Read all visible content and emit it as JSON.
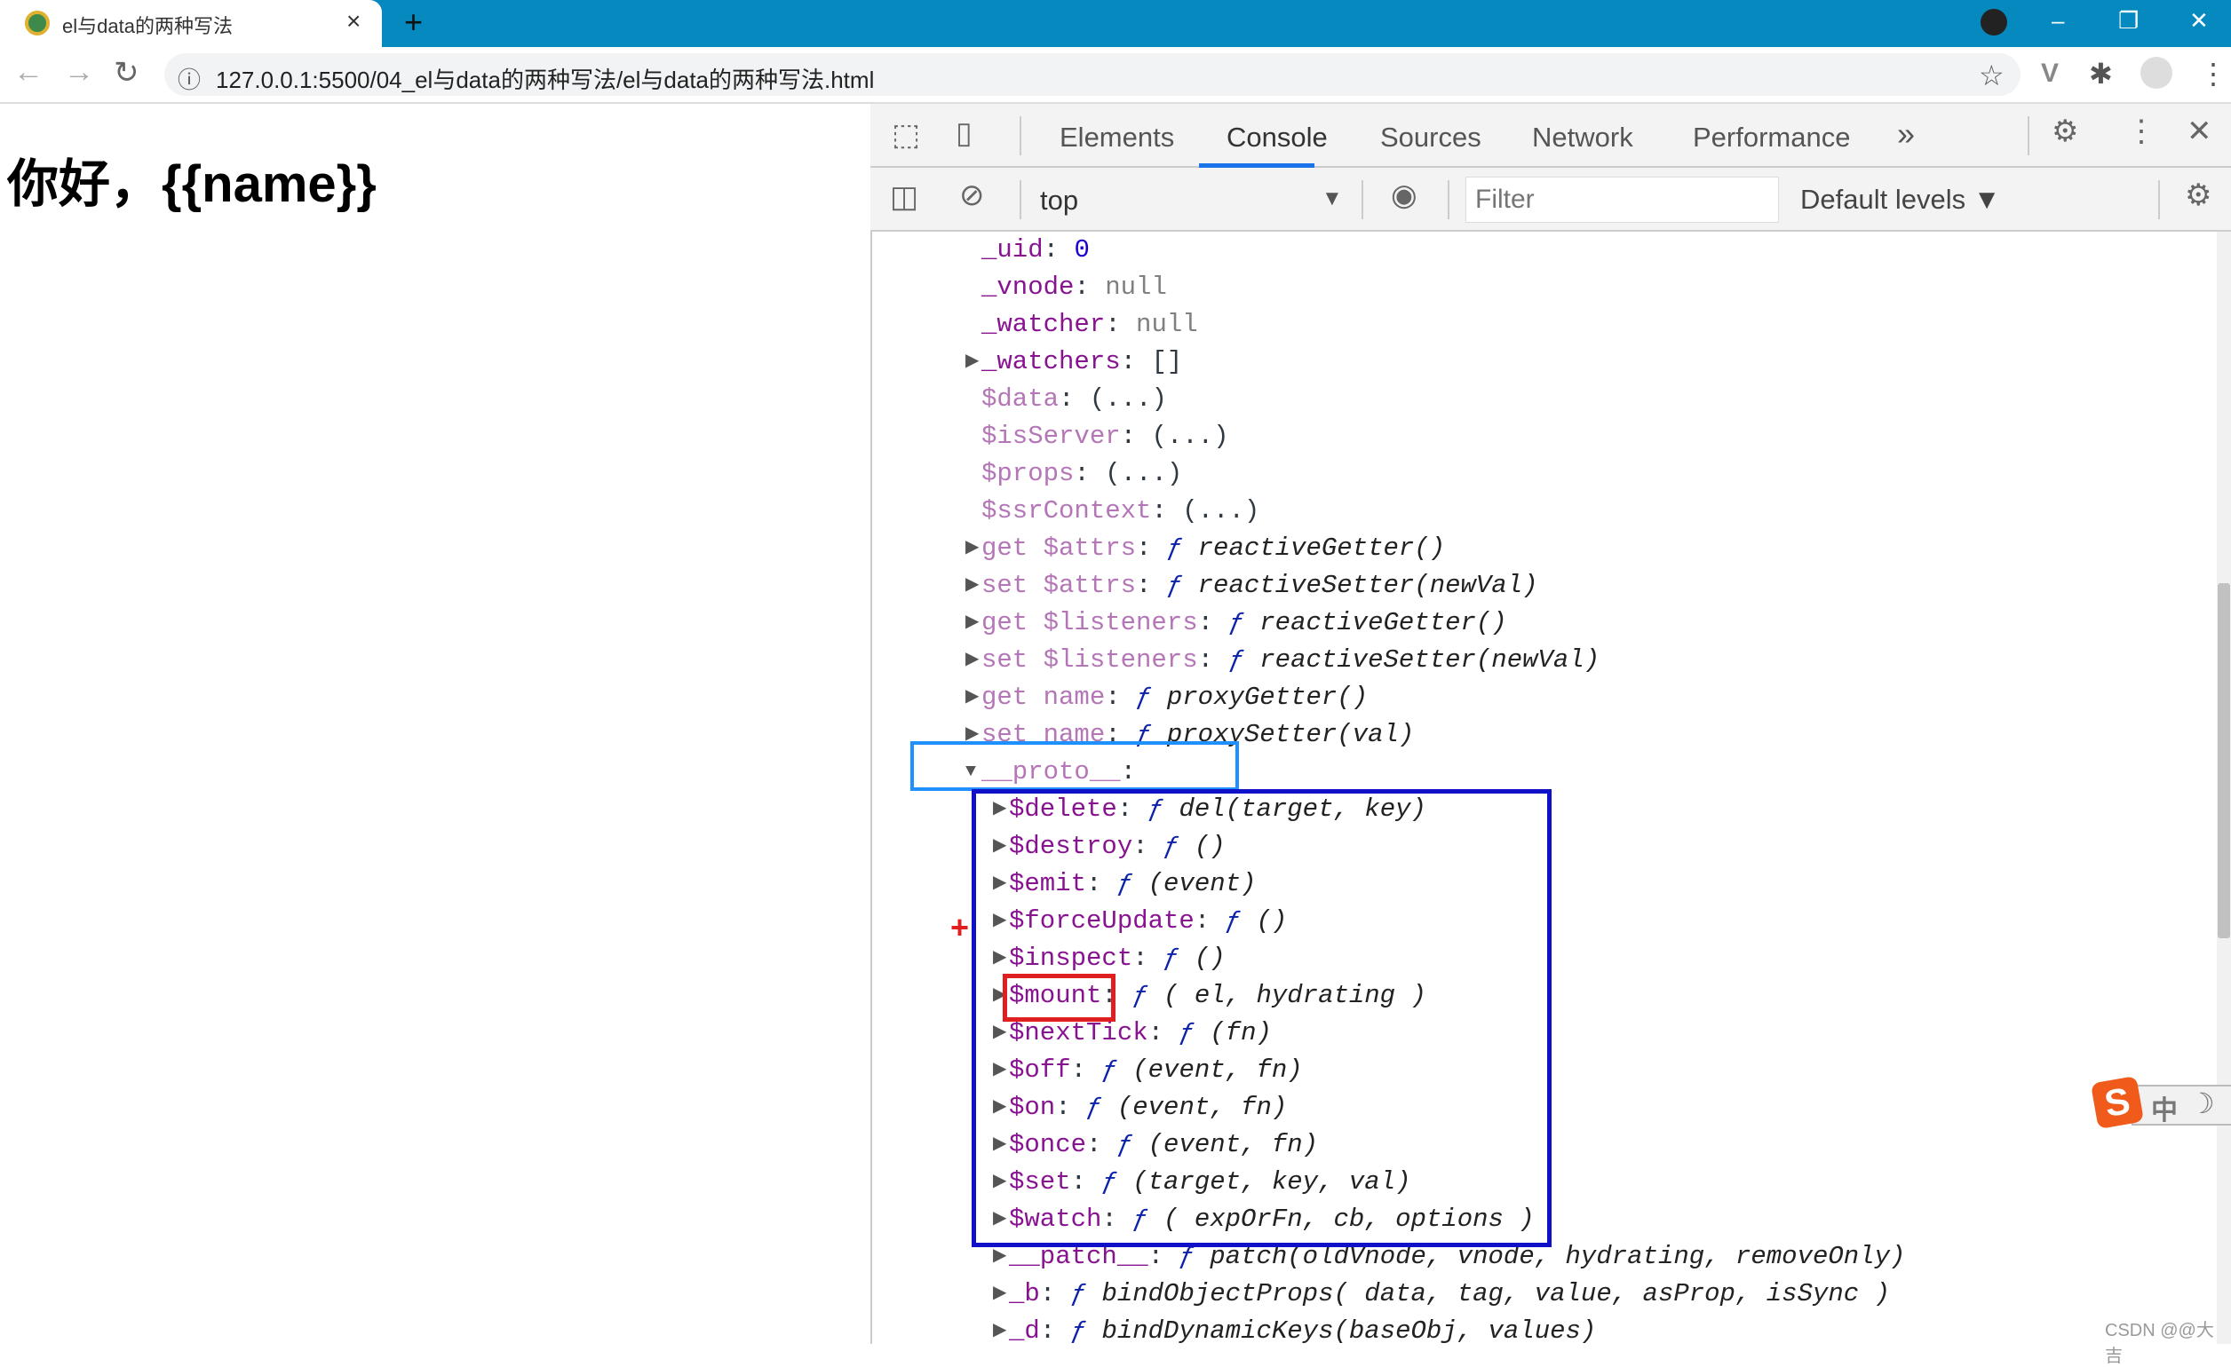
{
  "browser": {
    "tab_title": "el与data的两种写法",
    "tab_close": "×",
    "new_tab": "+",
    "url": "127.0.0.1:5500/04_el与data的两种写法/el与data的两种写法.html",
    "window_controls": {
      "minimize": "–",
      "restore": "❐",
      "close": "✕"
    }
  },
  "page": {
    "heading": "你好，{{name}}"
  },
  "devtools": {
    "tabs": [
      "Elements",
      "Console",
      "Sources",
      "Network",
      "Performance"
    ],
    "active_tab": "Console",
    "more_tabs": "»",
    "context": "top",
    "filter_placeholder": "Filter",
    "levels": "Default levels ▼",
    "console_lines": [
      {
        "indent": 0,
        "arrow": "",
        "key": "_uid",
        "dim": false,
        "val": "0",
        "vt": "num"
      },
      {
        "indent": 0,
        "arrow": "",
        "key": "_vnode",
        "dim": false,
        "val": "null",
        "vt": "nul"
      },
      {
        "indent": 0,
        "arrow": "",
        "key": "_watcher",
        "dim": false,
        "val": "null",
        "vt": "nul"
      },
      {
        "indent": 0,
        "arrow": "▶",
        "key": "_watchers",
        "dim": false,
        "val": "[]",
        "vt": "p"
      },
      {
        "indent": 0,
        "arrow": "",
        "key": "$data",
        "dim": true,
        "val": "(...)",
        "vt": "p"
      },
      {
        "indent": 0,
        "arrow": "",
        "key": "$isServer",
        "dim": true,
        "val": "(...)",
        "vt": "p"
      },
      {
        "indent": 0,
        "arrow": "",
        "key": "$props",
        "dim": true,
        "val": "(...)",
        "vt": "p"
      },
      {
        "indent": 0,
        "arrow": "",
        "key": "$ssrContext",
        "dim": true,
        "val": "(...)",
        "vt": "p"
      },
      {
        "indent": 0,
        "arrow": "▶",
        "key": "get $attrs",
        "dim": true,
        "val": "reactiveGetter()",
        "vt": "fn"
      },
      {
        "indent": 0,
        "arrow": "▶",
        "key": "set $attrs",
        "dim": true,
        "val": "reactiveSetter(newVal)",
        "vt": "fn"
      },
      {
        "indent": 0,
        "arrow": "▶",
        "key": "get $listeners",
        "dim": true,
        "val": "reactiveGetter()",
        "vt": "fn"
      },
      {
        "indent": 0,
        "arrow": "▶",
        "key": "set $listeners",
        "dim": true,
        "val": "reactiveSetter(newVal)",
        "vt": "fn"
      },
      {
        "indent": 0,
        "arrow": "▶",
        "key": "get name",
        "dim": true,
        "val": "proxyGetter()",
        "vt": "fn"
      },
      {
        "indent": 0,
        "arrow": "▶",
        "key": "set name",
        "dim": true,
        "val": "proxySetter(val)",
        "vt": "fn"
      },
      {
        "indent": 0,
        "arrow": "▼",
        "key": "__proto__",
        "dim": true,
        "val": "",
        "vt": "p"
      },
      {
        "indent": 1,
        "arrow": "▶",
        "key": "$delete",
        "dim": false,
        "val": "del(target, key)",
        "vt": "fn"
      },
      {
        "indent": 1,
        "arrow": "▶",
        "key": "$destroy",
        "dim": false,
        "val": "()",
        "vt": "fn"
      },
      {
        "indent": 1,
        "arrow": "▶",
        "key": "$emit",
        "dim": false,
        "val": "(event)",
        "vt": "fn"
      },
      {
        "indent": 1,
        "arrow": "▶",
        "key": "$forceUpdate",
        "dim": false,
        "val": "()",
        "vt": "fn"
      },
      {
        "indent": 1,
        "arrow": "▶",
        "key": "$inspect",
        "dim": false,
        "val": "()",
        "vt": "fn"
      },
      {
        "indent": 1,
        "arrow": "▶",
        "key": "$mount",
        "dim": false,
        "val": "( el, hydrating )",
        "vt": "fn"
      },
      {
        "indent": 1,
        "arrow": "▶",
        "key": "$nextTick",
        "dim": false,
        "val": "(fn)",
        "vt": "fn"
      },
      {
        "indent": 1,
        "arrow": "▶",
        "key": "$off",
        "dim": false,
        "val": "(event, fn)",
        "vt": "fn"
      },
      {
        "indent": 1,
        "arrow": "▶",
        "key": "$on",
        "dim": false,
        "val": "(event, fn)",
        "vt": "fn"
      },
      {
        "indent": 1,
        "arrow": "▶",
        "key": "$once",
        "dim": false,
        "val": "(event, fn)",
        "vt": "fn"
      },
      {
        "indent": 1,
        "arrow": "▶",
        "key": "$set",
        "dim": false,
        "val": "(target, key, val)",
        "vt": "fn"
      },
      {
        "indent": 1,
        "arrow": "▶",
        "key": "$watch",
        "dim": false,
        "val": "( expOrFn, cb, options )",
        "vt": "fn"
      },
      {
        "indent": 1,
        "arrow": "▶",
        "key": "__patch__",
        "dim": false,
        "val": "patch(oldVnode, vnode, hydrating, removeOnly)",
        "vt": "fn"
      },
      {
        "indent": 1,
        "arrow": "▶",
        "key": "_b",
        "dim": false,
        "val": "bindObjectProps( data, tag, value, asProp, isSync )",
        "vt": "fn"
      },
      {
        "indent": 1,
        "arrow": "▶",
        "key": "_d",
        "dim": false,
        "val": "bindDynamicKeys(baseObj, values)",
        "vt": "fn"
      }
    ]
  },
  "annotations": {
    "plus_marker": "+"
  },
  "ime": {
    "logo": "S",
    "mode": "中",
    "moon": "☽"
  },
  "watermark": "CSDN @@大吉",
  "colors": {
    "titlebar": "#0589bf",
    "highlight_proto": "#1e90ff",
    "highlight_methods": "#1010c8",
    "highlight_mount": "#e02020",
    "tab_underline": "#1a73e8"
  }
}
